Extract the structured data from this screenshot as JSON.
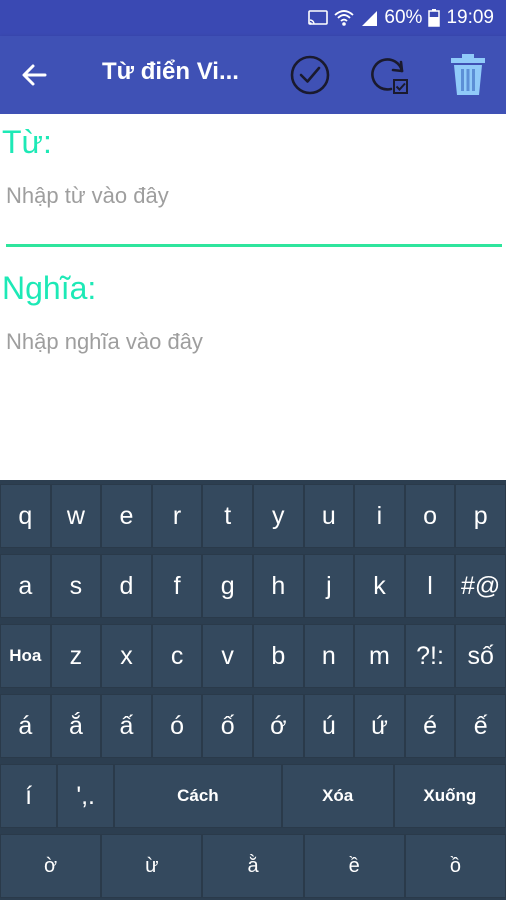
{
  "status": {
    "battery_pct": "60%",
    "time": "19:09"
  },
  "appbar": {
    "title": "Từ điển Vi..."
  },
  "form": {
    "word_label": "Từ:",
    "word_placeholder": "Nhập từ vào đây",
    "meaning_label": "Nghĩa:",
    "meaning_placeholder": "Nhập nghĩa vào đây"
  },
  "keyboard": {
    "rows": [
      [
        "q",
        "w",
        "e",
        "r",
        "t",
        "y",
        "u",
        "i",
        "o",
        "p"
      ],
      [
        "a",
        "s",
        "d",
        "f",
        "g",
        "h",
        "j",
        "k",
        "l",
        "#@"
      ],
      [
        "Hoa",
        "z",
        "x",
        "c",
        "v",
        "b",
        "n",
        "m",
        "?!:",
        "số"
      ],
      [
        "á",
        "ắ",
        "ấ",
        "ó",
        "ố",
        "ớ",
        "ú",
        "ứ",
        "é",
        "ế"
      ],
      [
        "í",
        "',.",
        "Cách",
        "Xóa",
        "Xuống"
      ],
      [
        "ờ",
        "ừ",
        "ằ",
        "ề",
        "ồ"
      ]
    ]
  },
  "colors": {
    "appbar": "#3f51b5",
    "statusbar": "#3a49b3",
    "accent": "#1de9b6",
    "keyboard": "#34495e"
  }
}
